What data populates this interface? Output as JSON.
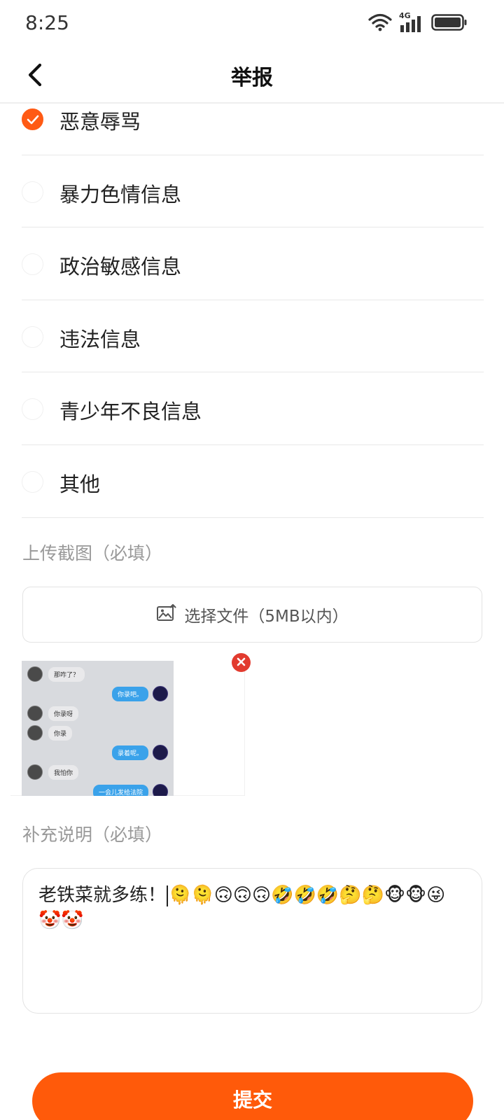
{
  "status_bar": {
    "time": "8:25",
    "icons": [
      "wifi-icon",
      "signal-4g-icon",
      "battery-icon"
    ],
    "network_label": "4G"
  },
  "nav": {
    "title": "举报",
    "back_icon": "chevron-left-icon"
  },
  "options": [
    {
      "label": "恶意辱骂",
      "checked": true
    },
    {
      "label": "暴力色情信息",
      "checked": false
    },
    {
      "label": "政治敏感信息",
      "checked": false
    },
    {
      "label": "违法信息",
      "checked": false
    },
    {
      "label": "青少年不良信息",
      "checked": false
    },
    {
      "label": "其他",
      "checked": false
    }
  ],
  "upload": {
    "section_title": "上传截图（必填）",
    "button_label": "选择文件（5MB以内）",
    "button_icon": "image-upload-icon"
  },
  "screenshot_preview": {
    "messages": [
      {
        "side": "left",
        "text": "那咋了？"
      },
      {
        "side": "right",
        "text": "你录吧。"
      },
      {
        "side": "left",
        "text": "你录呀"
      },
      {
        "side": "left",
        "text": "你录"
      },
      {
        "side": "right",
        "text": "录着呢。"
      },
      {
        "side": "left",
        "text": "我怕你"
      },
      {
        "side": "right",
        "text": "一会儿发给法院"
      }
    ]
  },
  "description": {
    "section_title": "补充说明（必填）",
    "text_before_caret": "老铁菜就多练！",
    "text_after_caret": "🫠🫠🙃🙃🙃🤣🤣🤣🤔🤔🐵🐵😜🤡🤡"
  },
  "submit": {
    "label": "提交"
  },
  "colors": {
    "accent": "#ff5a0a",
    "check": "#ff5a14",
    "remove": "#e23b2f"
  }
}
